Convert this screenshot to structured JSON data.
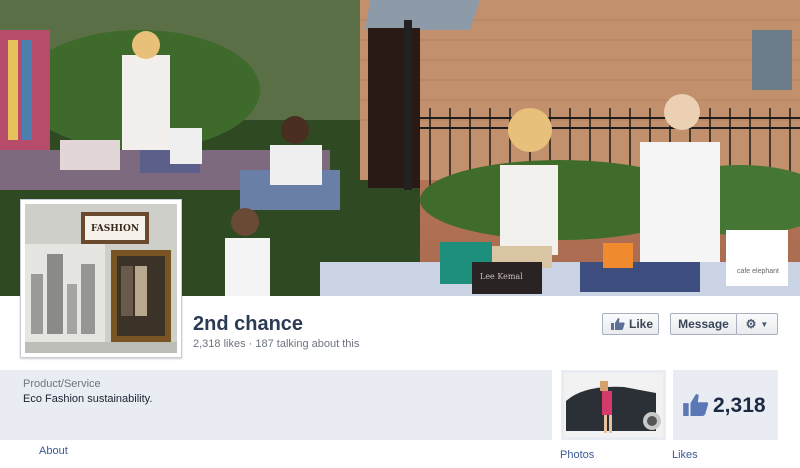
{
  "page": {
    "name": "2nd chance",
    "stats": "2,318 likes · 187 talking about this",
    "category": "Product/Service",
    "description": "Eco Fashion sustainability."
  },
  "cover": {
    "bag_text": "Lee Kemal",
    "box_text": "cafe elephant"
  },
  "profile": {
    "sign_text": "FASHION"
  },
  "actions": {
    "like_label": "Like",
    "message_label": "Message",
    "settings_icon": "gear-icon"
  },
  "tabs": {
    "about_label": "About",
    "photos_label": "Photos",
    "likes_label": "Likes",
    "likes_count": "2,318"
  },
  "colors": {
    "link": "#3b5998",
    "panel": "#e9ecf3",
    "name": "#2b3a55"
  }
}
